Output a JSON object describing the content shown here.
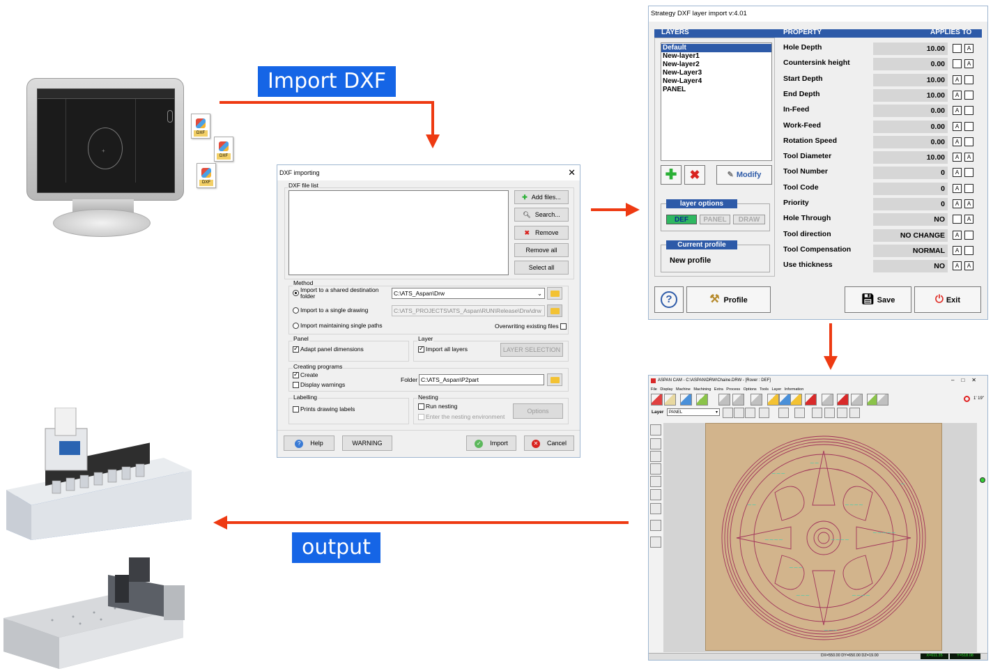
{
  "labels": {
    "import_dxf": "Import DXF",
    "output": "output"
  },
  "colors": {
    "arrow": "#ee3a12",
    "label_bg": "#1565e6",
    "selection": "#2d5aa8"
  },
  "file_icons": [
    {
      "type": "DXF"
    },
    {
      "type": "DXF"
    },
    {
      "type": "DXF"
    }
  ],
  "dxf_dialog": {
    "title": "DXF importing",
    "file_list_label": "DXF file list",
    "buttons": {
      "add_files": "Add files...",
      "search": "Search...",
      "remove": "Remove",
      "remove_all": "Remove all",
      "select_all": "Select all"
    },
    "method": {
      "label": "Method",
      "opt_shared": "Import to a shared destination folder",
      "shared_path": "C:\\ATS_Aspan\\Drw",
      "opt_single": "Import to a single drawing",
      "single_path": "C:\\ATS_PROJECTS\\ATS_Aspan\\RUN\\Release\\Drw\\drw",
      "opt_maintain": "Import maintaining single paths",
      "overwrite": "Overwriting existing files"
    },
    "panel": {
      "label": "Panel",
      "adapt": "Adapt panel dimensions"
    },
    "layer": {
      "label": "Layer",
      "import_all": "Import all layers",
      "layer_selection": "LAYER SELECTION"
    },
    "creating": {
      "label": "Creating programs",
      "create": "Create",
      "display_warnings": "Display warnings",
      "folder_label": "Folder",
      "folder_value": "C:\\ATS_Aspan\\P2part"
    },
    "labelling": {
      "label": "Labelling",
      "prints": "Prints drawing labels"
    },
    "nesting": {
      "label": "Nesting",
      "run": "Run nesting",
      "enter": "Enter the nesting environment",
      "options": "Options"
    },
    "footer": {
      "help": "Help",
      "warning": "WARNING",
      "import": "Import",
      "cancel": "Cancel"
    }
  },
  "strategy": {
    "title": "Strategy DXF layer import v:4.01",
    "layers_header": "LAYERS",
    "property_header": "PROPERTY",
    "applies_header": "APPLIES TO",
    "layers": [
      "Default",
      "New-layer1",
      "New-layer2",
      "New-Layer3",
      "New-Layer4",
      "PANEL"
    ],
    "modify": "Modify",
    "layer_options": "layer options",
    "opt_def": "DEF",
    "opt_panel": "PANEL",
    "opt_draw": "DRAW",
    "current_profile": "Current profile",
    "new_profile": "New profile",
    "properties": [
      {
        "name": "Hole Depth",
        "value": "10.00"
      },
      {
        "name": "Countersink height",
        "value": "0.00"
      },
      {
        "name": "Start Depth",
        "value": "10.00"
      },
      {
        "name": "End Depth",
        "value": "10.00"
      },
      {
        "name": "In-Feed",
        "value": "0.00"
      },
      {
        "name": "Work-Feed",
        "value": "0.00"
      },
      {
        "name": "Rotation Speed",
        "value": "0.00"
      },
      {
        "name": "Tool Diameter",
        "value": "10.00"
      },
      {
        "name": "Tool Number",
        "value": "0"
      },
      {
        "name": "Tool Code",
        "value": "0"
      },
      {
        "name": "Priority",
        "value": "0"
      },
      {
        "name": "Hole Through",
        "value": "NO"
      },
      {
        "name": "Tool direction",
        "value": "NO CHANGE"
      },
      {
        "name": "Tool Compensation",
        "value": "NORMAL"
      },
      {
        "name": "Use thickness",
        "value": "NO"
      }
    ],
    "profile": "Profile",
    "save": "Save",
    "exit": "Exit"
  },
  "cam": {
    "title": "ASPAN CAM - C:\\ASPAN\\DRW\\Chaine.DRW - [Rover : DEF]",
    "menu": [
      "File",
      "Display",
      "Machine",
      "Machining",
      "Extra",
      "Process",
      "Options",
      "Tools",
      "Layer",
      "Information"
    ],
    "layer_label": "Layer",
    "layer_value": "PANEL",
    "time": "1' 19\"",
    "status": "DX=550.00 DY=650.00 DZ=19.00",
    "coord_x": "X=611.35",
    "coord_y": "Y=518.08"
  }
}
